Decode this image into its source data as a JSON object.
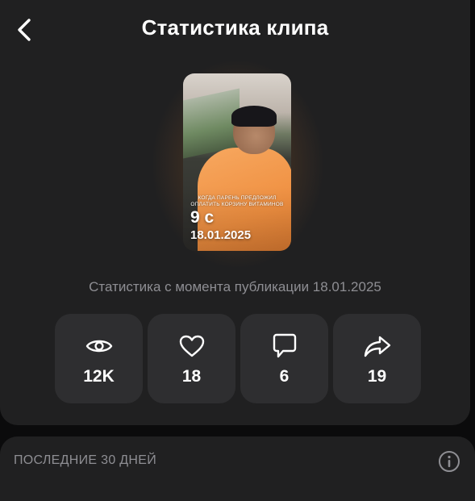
{
  "header": {
    "title": "Статистика клипа",
    "back_icon": "chevron-left-icon"
  },
  "clip": {
    "caption": "КОГДА ПАРЕНЬ ПРЕДЛОЖИЛ ОПЛАТИТЬ КОРЗИНУ ВИТАМИНОВ",
    "duration": "9 с",
    "date": "18.01.2025"
  },
  "subtitle": "Статистика с момента публикации 18.01.2025",
  "stats": [
    {
      "icon": "eye-icon",
      "value": "12K"
    },
    {
      "icon": "heart-icon",
      "value": "18"
    },
    {
      "icon": "comment-icon",
      "value": "6"
    },
    {
      "icon": "share-icon",
      "value": "19"
    }
  ],
  "period": {
    "label": "ПОСЛЕДНИЕ 30 ДНЕЙ",
    "info_icon": "info-icon"
  },
  "colors": {
    "background": "#202021",
    "card": "#2e2e30",
    "muted_text": "#8e8e93"
  }
}
